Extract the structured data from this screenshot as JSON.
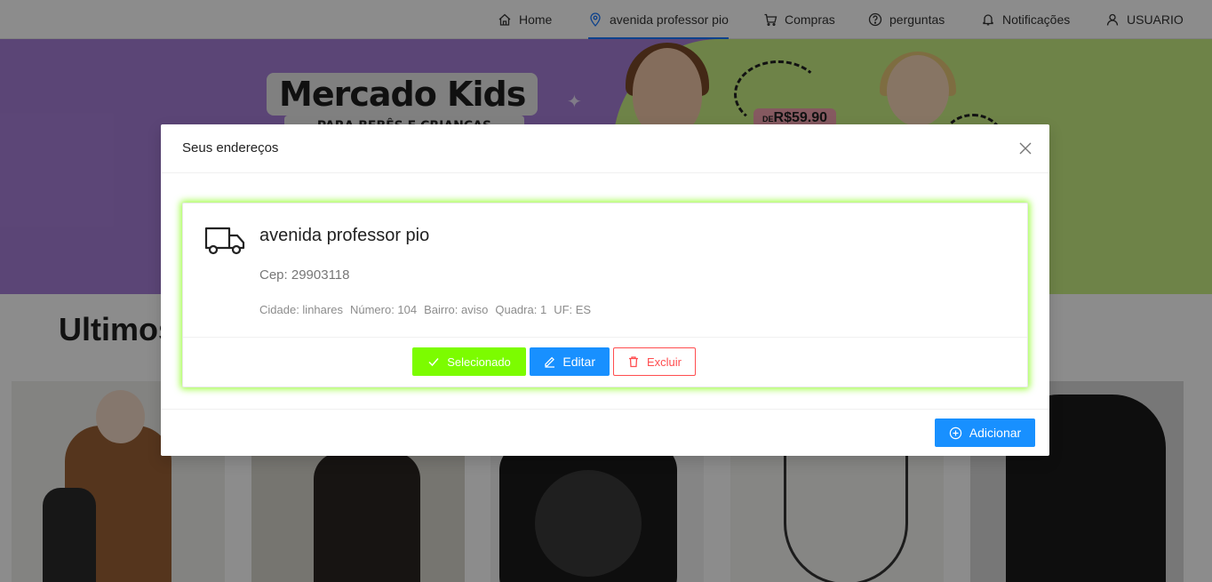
{
  "nav": {
    "items": [
      {
        "label": "Home",
        "icon": "home-icon"
      },
      {
        "label": "avenida professor pio",
        "icon": "location-pin-icon",
        "active": true
      },
      {
        "label": "Compras",
        "icon": "cart-icon"
      },
      {
        "label": "perguntas",
        "icon": "question-circle-icon"
      },
      {
        "label": "Notificações",
        "icon": "bell-icon"
      },
      {
        "label": "USUARIO",
        "icon": "user-icon"
      }
    ],
    "accent": "#1677ff"
  },
  "banner": {
    "title": "Mercado Kids",
    "subtitle": "PARA BEBÊS E CRIANÇAS",
    "price_prefix": "DE",
    "price": "R$59.90"
  },
  "section": {
    "title": "Ultimos"
  },
  "modal": {
    "title": "Seus endereços",
    "close_icon": "close-icon",
    "address": {
      "name": "avenida professor pio",
      "cep": "Cep: 29903118",
      "details": [
        "Cidade: linhares",
        "Número: 104",
        "Bairro: aviso",
        "Quadra: 1",
        "UF: ES"
      ],
      "selected_label": "Selecionado",
      "edit_label": "Editar",
      "delete_label": "Excluir"
    },
    "add_label": "Adicionar"
  },
  "colors": {
    "selected": "#7cfc00",
    "primary": "#1890ff",
    "danger": "#ff4d4f"
  }
}
